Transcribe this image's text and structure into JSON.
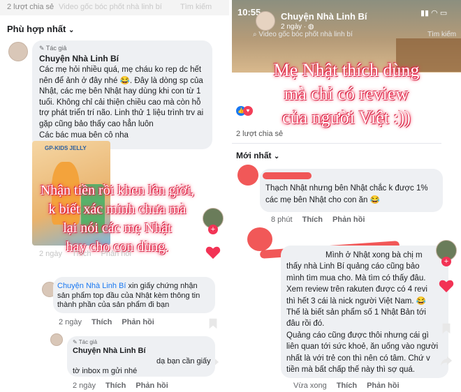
{
  "left": {
    "top_share": "2 lượt chia sẻ",
    "top_bar_ghost": "Video gốc bóc phốt nhà linh bí",
    "top_search": "Tìm kiếm",
    "sort": "Phù hợp nhất",
    "author_tag": "Tác giả",
    "author": "Chuyện Nhà Linh Bí",
    "comment_lines": [
      "Các mẹ hỏi nhiều quá, mẹ cháu ko rep dc hết",
      "nên để ảnh ở đây nhé 😂. Đây là dòng sp của",
      "Nhật, các mẹ bên Nhật hay dùng khi con từ 1",
      "tuổi.  Không chỉ cải thiện chiều cao mà còn hỗ",
      "trợ phát triển trí não. Linh thử 1 liệu trình trv ai",
      "gặp cũng bảo thấy cao hẳn luôn",
      "Các bác mua bên cô                         nha"
    ],
    "product_label": "GP-KIDS JELLY",
    "overlay": [
      "Nhận tiền rồi khen lên giời,",
      "k biết xác minh chưa mà",
      "lại nói các mẹ Nhật",
      "hay cho con dùng."
    ],
    "first_meta": [
      "2 ngày",
      "Thích",
      "Phản hồi"
    ],
    "reply1_author": "Chuyện Nhà Linh Bí",
    "reply1_lines": [
      "xin giấy chứng nhận",
      "sản phẩm top đầu của Nhật kèm thông tin",
      "thành phần của sản phẩm đi bạn"
    ],
    "reply1_meta": [
      "2 ngày",
      "Thích",
      "Phản hồi"
    ],
    "reply2_tag": "Tác giả",
    "reply2_author": "Chuyện Nhà Linh Bí",
    "reply2_lines": [
      "dạ bạn cần giấy",
      "tờ inbox m gửi nhé"
    ],
    "reply2_meta": [
      "2 ngày",
      "Thích",
      "Phản hồi"
    ]
  },
  "right": {
    "time": "10:55",
    "page_name": "Chuyện Nhà Linh Bí",
    "post_age": "2 ngày · ",
    "search_ghost": "Video gốc bóc phốt nhà linh bí",
    "search": "Tìm kiếm",
    "overlay": [
      "Mẹ Nhật thích dùng",
      "mà chỉ có review",
      "của người Việt :))"
    ],
    "shares": "2 lượt chia sẻ",
    "sort": "Mới nhất",
    "c1_lines": [
      "Thạch Nhật nhưng bên Nhật chắc k được 1%",
      "các mẹ bên Nhật cho con ăn 😂"
    ],
    "c1_meta": [
      "8 phút",
      "Thích",
      "Phản hồi"
    ],
    "c2_lines": [
      "Mình ở Nhật xong bà chị m",
      "thấy nhà Linh Bí quảng cáo cũng bảo",
      "mình tìm mua cho. Mà tìm có thấy đâu.",
      "Xem review trên rakuten được có 4 revi",
      "thì hết 3 cái là nick người Việt Nam. 😂",
      "Thế là biết sản phẩm số 1 Nhật Bản tới",
      "đâu rồi đó.",
      "Quảng cáo cũng được thôi nhưng cái gì",
      "liên quan tới sức khoẻ, ăn uống vào người",
      "nhất là với trẻ con thì nên có tâm. Chứ v",
      "tiền mà bất chấp thế này thì sợ quá."
    ],
    "c2_meta": [
      "Vừa xong",
      "Thích",
      "Phản hồi"
    ]
  }
}
